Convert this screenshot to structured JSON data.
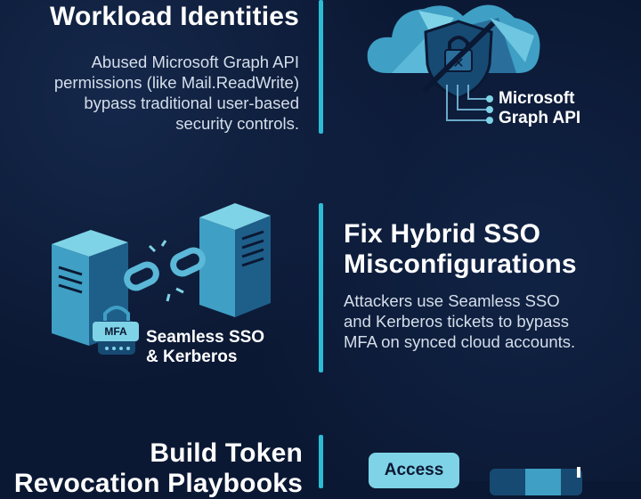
{
  "section1": {
    "title": "Workload Identities",
    "body_lines": [
      "Abused Microsoft Graph API",
      "permissions (like Mail.ReadWrite)",
      "bypass traditional user-based",
      "security controls."
    ],
    "label_lines": [
      "Microsoft",
      "Graph API"
    ]
  },
  "section2": {
    "title_lines": [
      "Fix Hybrid SSO",
      "Misconfigurations"
    ],
    "body_lines": [
      "Attackers use Seamless SSO",
      "and Kerberos tickets to bypass",
      "MFA on synced cloud accounts."
    ],
    "label_lines": [
      "Seamless SSO",
      "& Kerberos"
    ],
    "badge": "MFA"
  },
  "section3": {
    "title_lines": [
      "Build Token",
      "Revocation Playbooks"
    ],
    "badge": "Access"
  },
  "colors": {
    "background": "#0b1833",
    "accent": "#2bbcd6",
    "light_accent": "#7fd3e6",
    "server": "#3f9fc4"
  },
  "icons": [
    "cloud-icon",
    "crossed-lock-shield-icon",
    "server-icon",
    "broken-chain-icon",
    "padlock-icon"
  ]
}
